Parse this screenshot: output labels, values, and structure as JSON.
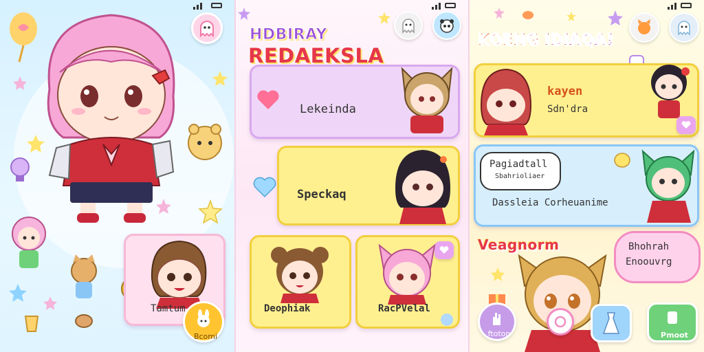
{
  "panel1": {
    "status": "",
    "character_label": "Tamtum",
    "fab_label": "Bcomi"
  },
  "panel2": {
    "title_line1": "HDBIRAY",
    "title_line2": "REDAEKSLA",
    "cards": [
      {
        "label": "Lekeinda"
      },
      {
        "label": "Speckaq"
      },
      {
        "label": "Deophiak"
      },
      {
        "label": "RacPVelal"
      }
    ]
  },
  "panel3": {
    "title": "KOENG IDIAQA!",
    "card1_title": "kayen",
    "card1_sub": "Sdn'dra",
    "bubble1_line1": "Pagiadtall",
    "bubble1_line2": "Sbahrioliaer",
    "card2_label": "Dassleia Corheuanime",
    "section_title": "Veagnorm",
    "bubble2_line1": "Bhohrah",
    "bubble2_line2": "Enoouvrg",
    "btn_left_label": "ftoton",
    "btn_right_label": "Pmoot"
  },
  "colors": {
    "pink": "#f8b9dc",
    "yellow": "#fde774",
    "lavender": "#e9c9f5",
    "sky": "#cfeafc",
    "green": "#6fd27a",
    "purple": "#b58ae6"
  }
}
